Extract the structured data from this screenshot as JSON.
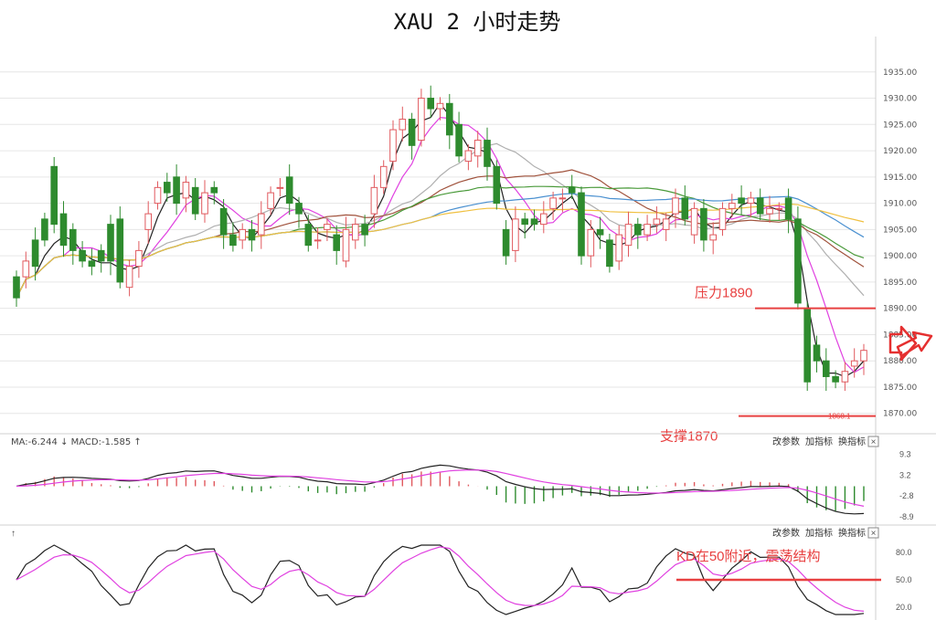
{
  "chart_data": {
    "type": "candlestick",
    "title": "XAU 2 小时走势",
    "colors": {
      "up": "#e0595e",
      "down": "#2e8b2e",
      "ma_black": "#222222",
      "ma_pink": "#e040e0",
      "ma_gray": "#b0b0b0",
      "ma_brown": "#a0523c",
      "ma_green": "#4a9a3a",
      "ma_blue": "#4a90d0",
      "ma_orange": "#f0c040",
      "annotation": "#e84040",
      "grid": "#e6e6e6"
    },
    "price_axis": {
      "ylim": [
        1867,
        1940
      ],
      "ticks": [
        "1935.00",
        "1930.00",
        "1925.00",
        "1920.00",
        "1915.00",
        "1910.00",
        "1905.00",
        "1900.00",
        "1895.00",
        "1890.00",
        "1885.00",
        "1880.00",
        "1875.00",
        "1870.00"
      ]
    },
    "candles": [
      [
        1896,
        1892
      ],
      [
        1896,
        1899
      ],
      [
        1903,
        1898
      ],
      [
        1907,
        1903
      ],
      [
        1917,
        1906
      ],
      [
        1908,
        1902
      ],
      [
        1905,
        1901
      ],
      [
        1901,
        1899
      ],
      [
        1899,
        1898
      ],
      [
        1901,
        1899
      ],
      [
        1906,
        1899
      ],
      [
        1907,
        1895
      ],
      [
        1894,
        1898
      ],
      [
        1898,
        1901
      ],
      [
        1905,
        1908
      ],
      [
        1910,
        1913
      ],
      [
        1914,
        1912
      ],
      [
        1915,
        1910
      ],
      [
        1911,
        1914
      ],
      [
        1913,
        1908
      ],
      [
        1908,
        1912
      ],
      [
        1913,
        1912
      ],
      [
        1909,
        1904
      ],
      [
        1904,
        1902
      ],
      [
        1903,
        1905
      ],
      [
        1905,
        1903
      ],
      [
        1904,
        1908
      ],
      [
        1909,
        1912
      ],
      [
        1913,
        1913
      ],
      [
        1915,
        1910
      ],
      [
        1910,
        1908
      ],
      [
        1906,
        1902
      ],
      [
        1903,
        1903
      ],
      [
        1905,
        1906
      ],
      [
        1904,
        1901
      ],
      [
        1899,
        1905
      ],
      [
        1903,
        1906
      ],
      [
        1906,
        1904
      ],
      [
        1908,
        1913
      ],
      [
        1913,
        1917
      ],
      [
        1918,
        1924
      ],
      [
        1924,
        1926
      ],
      [
        1926,
        1921
      ],
      [
        1922,
        1930
      ],
      [
        1930,
        1928
      ],
      [
        1928,
        1929
      ],
      [
        1929,
        1923
      ],
      [
        1925,
        1919
      ],
      [
        1918,
        1920
      ],
      [
        1919,
        1922
      ],
      [
        1922,
        1917
      ],
      [
        1917,
        1910
      ],
      [
        1905,
        1900
      ],
      [
        1901,
        1907
      ],
      [
        1907,
        1906
      ],
      [
        1907,
        1906
      ],
      [
        1906,
        1908
      ],
      [
        1909,
        1911
      ],
      [
        1911,
        1911
      ],
      [
        1913,
        1912
      ],
      [
        1912,
        1900
      ],
      [
        1900,
        1905
      ],
      [
        1905,
        1904
      ],
      [
        1903,
        1898
      ],
      [
        1899,
        1904
      ],
      [
        1902,
        1906
      ],
      [
        1906,
        1904
      ],
      [
        1904,
        1906
      ],
      [
        1906,
        1907
      ],
      [
        1905,
        1907
      ],
      [
        1908,
        1911
      ],
      [
        1911,
        1907
      ],
      [
        1904,
        1909
      ],
      [
        1909,
        1903
      ],
      [
        1903,
        1904
      ],
      [
        1905,
        1909
      ],
      [
        1909,
        1910
      ],
      [
        1911,
        1910
      ],
      [
        1910,
        1911
      ],
      [
        1911,
        1908
      ],
      [
        1908,
        1909
      ],
      [
        1909,
        1909
      ],
      [
        1911,
        1907
      ],
      [
        1907,
        1891
      ],
      [
        1890,
        1876
      ],
      [
        1883,
        1880
      ],
      [
        1880,
        1877
      ],
      [
        1877,
        1876
      ],
      [
        1876,
        1878
      ],
      [
        1879,
        1880
      ],
      [
        1880,
        1882
      ]
    ],
    "price_annotations": [
      {
        "label": "压力1890",
        "value": 1890
      },
      {
        "label": "支撑1870",
        "value": 1869.5
      },
      {
        "label": "1868.1",
        "value": 1869.5
      }
    ],
    "macd_panel": {
      "header": "MA:-6.244 ↓  MACD:-1.585 ↑",
      "controls": [
        "改参数",
        "加指标",
        "换指标"
      ],
      "close_icon": "×",
      "ticks": [
        "9.3",
        "3.2",
        "-2.8",
        "-8.9"
      ],
      "ylim": [
        -10,
        10
      ]
    },
    "kd_panel": {
      "header": "↑",
      "controls": [
        "改参数",
        "加指标",
        "换指标"
      ],
      "close_icon": "×",
      "ticks": [
        "80.0",
        "50.0",
        "20.0"
      ],
      "ylim": [
        10,
        90
      ],
      "annotation": "KD在50附近，震荡结构",
      "level": 50
    },
    "arrow_icon": "right-arrow-icon"
  }
}
